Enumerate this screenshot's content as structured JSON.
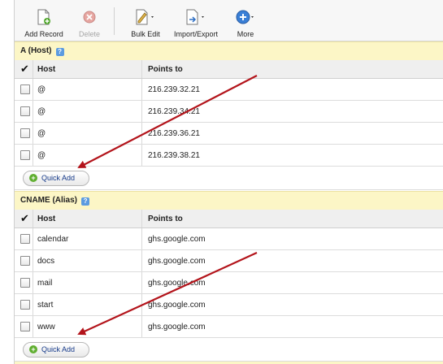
{
  "toolbar": {
    "add_record": "Add Record",
    "delete": "Delete",
    "bulk_edit": "Bulk Edit",
    "import_export": "Import/Export",
    "more": "More"
  },
  "sections": {
    "a": {
      "title": "A (Host)",
      "col_host": "Host",
      "col_points": "Points to",
      "rows": [
        {
          "host": "@",
          "points": "216.239.32.21"
        },
        {
          "host": "@",
          "points": "216.239.34.21"
        },
        {
          "host": "@",
          "points": "216.239.36.21"
        },
        {
          "host": "@",
          "points": "216.239.38.21"
        }
      ],
      "quick_add": "Quick Add"
    },
    "cname": {
      "title": "CNAME (Alias)",
      "col_host": "Host",
      "col_points": "Points to",
      "rows": [
        {
          "host": "calendar",
          "points": "ghs.google.com"
        },
        {
          "host": "docs",
          "points": "ghs.google.com"
        },
        {
          "host": "mail",
          "points": "ghs.google.com"
        },
        {
          "host": "start",
          "points": "ghs.google.com"
        },
        {
          "host": "www",
          "points": "ghs.google.com"
        }
      ],
      "quick_add": "Quick Add"
    }
  },
  "colors": {
    "section_bg": "#fcf6c6",
    "arrow": "#b3141b",
    "quick_add_text": "#163a8a"
  }
}
